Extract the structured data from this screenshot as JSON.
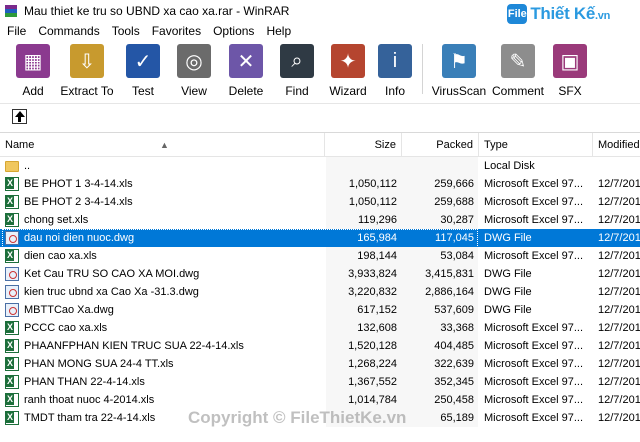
{
  "window": {
    "title": "Mau thiet ke tru so UBND xa cao xa.rar - WinRAR"
  },
  "brand": {
    "badge": "File",
    "text": "Thiết Kế",
    "suffix": ".vn"
  },
  "menu": [
    "File",
    "Commands",
    "Tools",
    "Favorites",
    "Options",
    "Help"
  ],
  "toolbar": [
    {
      "label": "Add",
      "icon": "add-archive-icon",
      "color": "#8b3a8f"
    },
    {
      "label": "Extract To",
      "icon": "extract-to-icon",
      "color": "#c89a2e"
    },
    {
      "label": "Test",
      "icon": "test-icon",
      "color": "#2456a6"
    },
    {
      "label": "View",
      "icon": "view-glasses-icon",
      "color": "#6b6b6b"
    },
    {
      "label": "Delete",
      "icon": "delete-icon",
      "color": "#6d56a8"
    },
    {
      "label": "Find",
      "icon": "find-binoculars-icon",
      "color": "#2f3a44"
    },
    {
      "label": "Wizard",
      "icon": "wizard-icon",
      "color": "#b5452f"
    },
    {
      "label": "Info",
      "icon": "info-icon",
      "color": "#35629a"
    },
    {
      "label": "VirusScan",
      "icon": "virusscan-icon",
      "color": "#3a7fb8"
    },
    {
      "label": "Comment",
      "icon": "comment-icon",
      "color": "#8d8d8d"
    },
    {
      "label": "SFX",
      "icon": "sfx-icon",
      "color": "#9a3a7a"
    }
  ],
  "columns": {
    "name": "Name",
    "size": "Size",
    "packed": "Packed",
    "type": "Type",
    "modified": "Modified"
  },
  "files": [
    {
      "name": "..",
      "size": "",
      "packed": "",
      "type": "Local Disk",
      "modified": "",
      "kind": "folder"
    },
    {
      "name": "BE PHOT 1 3-4-14.xls",
      "size": "1,050,112",
      "packed": "259,666",
      "type": "Microsoft Excel 97...",
      "modified": "12/7/201",
      "kind": "xls"
    },
    {
      "name": "BE PHOT 2 3-4-14.xls",
      "size": "1,050,112",
      "packed": "259,688",
      "type": "Microsoft Excel 97...",
      "modified": "12/7/201",
      "kind": "xls"
    },
    {
      "name": "chong set.xls",
      "size": "119,296",
      "packed": "30,287",
      "type": "Microsoft Excel 97...",
      "modified": "12/7/201",
      "kind": "xls"
    },
    {
      "name": "dau noi dien nuoc.dwg",
      "size": "165,984",
      "packed": "117,045",
      "type": "DWG File",
      "modified": "12/7/201",
      "kind": "dwg",
      "selected": true
    },
    {
      "name": "dien cao xa.xls",
      "size": "198,144",
      "packed": "53,084",
      "type": "Microsoft Excel 97...",
      "modified": "12/7/201",
      "kind": "xls"
    },
    {
      "name": "Ket Cau TRU SO CAO XA MOI.dwg",
      "size": "3,933,824",
      "packed": "3,415,831",
      "type": "DWG File",
      "modified": "12/7/201",
      "kind": "dwg"
    },
    {
      "name": "kien truc ubnd xa Cao Xa -31.3.dwg",
      "size": "3,220,832",
      "packed": "2,886,164",
      "type": "DWG File",
      "modified": "12/7/201",
      "kind": "dwg"
    },
    {
      "name": "MBTTCao Xa.dwg",
      "size": "617,152",
      "packed": "537,609",
      "type": "DWG File",
      "modified": "12/7/201",
      "kind": "dwg"
    },
    {
      "name": "PCCC cao xa.xls",
      "size": "132,608",
      "packed": "33,368",
      "type": "Microsoft Excel 97...",
      "modified": "12/7/201",
      "kind": "xls"
    },
    {
      "name": "PHAANFPHAN KIEN TRUC SUA 22-4-14.xls",
      "size": "1,520,128",
      "packed": "404,485",
      "type": "Microsoft Excel 97...",
      "modified": "12/7/201",
      "kind": "xls"
    },
    {
      "name": "PHAN MONG SUA 24-4 TT.xls",
      "size": "1,268,224",
      "packed": "322,639",
      "type": "Microsoft Excel 97...",
      "modified": "12/7/201",
      "kind": "xls"
    },
    {
      "name": "PHAN THAN 22-4-14.xls",
      "size": "1,367,552",
      "packed": "352,345",
      "type": "Microsoft Excel 97...",
      "modified": "12/7/201",
      "kind": "xls"
    },
    {
      "name": "ranh thoat nuoc  4-2014.xls",
      "size": "1,014,784",
      "packed": "250,458",
      "type": "Microsoft Excel 97...",
      "modified": "12/7/201",
      "kind": "xls"
    },
    {
      "name": "TMDT tham tra 22-4-14.xls",
      "size": "",
      "packed": "65,189",
      "type": "Microsoft Excel 97...",
      "modified": "12/7/201",
      "kind": "xls"
    }
  ],
  "watermark": "Copyright © FileThietKe.vn"
}
